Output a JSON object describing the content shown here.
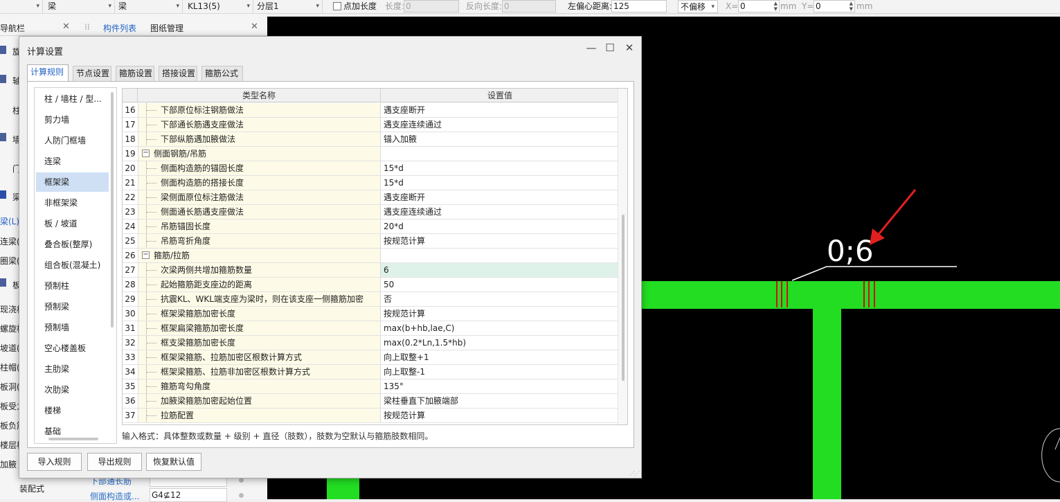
{
  "toolbar": {
    "type_value": "梁",
    "subtype_value": "梁",
    "component_value": "KL13(5)",
    "layer_value": "分层1",
    "point_length_label": "点加长度",
    "length_label": "长度:",
    "length_value": "0",
    "reverse_length_label": "反向长度:",
    "reverse_length_value": "0",
    "left_offset_label": "左偏心距离:",
    "left_offset_value": "125",
    "offset_mode": "不偏移",
    "x_label": "X=",
    "x_value": "0",
    "x_unit": "mm",
    "y_label": "Y=",
    "y_value": "0",
    "y_unit": "mm"
  },
  "left_panel": {
    "nav_tab": "导航栏",
    "component_list_tab": "构件列表",
    "drawing_tab": "图纸管理",
    "side_items": [
      "旋",
      "轴",
      "柱",
      "墙",
      "门",
      "梁",
      "梁(L)",
      "连梁(G",
      "圈梁(E",
      "板",
      "现浇板",
      "螺旋板",
      "坡道(P",
      "柱帽(V",
      "板洞(N",
      "板受力",
      "板负筋",
      "楼层板",
      "加腋",
      "装配式"
    ],
    "bottom_rows": [
      {
        "label": "下部通长筋",
        "value": ""
      },
      {
        "label": "侧面构造或...",
        "value": "G4⊈12"
      }
    ]
  },
  "canvas": {
    "annotation_text": "0;6"
  },
  "dialog": {
    "title": "计算设置",
    "tabs": [
      "计算规则",
      "节点设置",
      "箍筋设置",
      "搭接设置",
      "箍筋公式"
    ],
    "categories": [
      "柱 / 墙柱 / 型...",
      "剪力墙",
      "人防门框墙",
      "连梁",
      "框架梁",
      "非框架梁",
      "板 / 坡道",
      "叠合板(整厚)",
      "组合板(混凝土)",
      "预制柱",
      "预制梁",
      "预制墙",
      "空心楼盖板",
      "主肋梁",
      "次肋梁",
      "楼梯",
      "基础"
    ],
    "selected_category": "框架梁",
    "grid_headers": [
      "类型名称",
      "设置值"
    ],
    "rows": [
      {
        "num": "16",
        "name": "下部原位标注钢筋做法",
        "value": "遇支座断开"
      },
      {
        "num": "17",
        "name": "下部通长筋遇支座做法",
        "value": "遇支座连续通过"
      },
      {
        "num": "18",
        "name": "下部纵筋遇加腋做法",
        "value": "锚入加腋"
      },
      {
        "num": "19",
        "name": "侧面钢筋/吊筋",
        "value": "",
        "group": true
      },
      {
        "num": "20",
        "name": "侧面构造筋的锚固长度",
        "value": "15*d"
      },
      {
        "num": "21",
        "name": "侧面构造筋的搭接长度",
        "value": "15*d"
      },
      {
        "num": "22",
        "name": "梁侧面原位标注筋做法",
        "value": "遇支座断开"
      },
      {
        "num": "23",
        "name": "侧面通长筋遇支座做法",
        "value": "遇支座连续通过"
      },
      {
        "num": "24",
        "name": "吊筋锚固长度",
        "value": "20*d"
      },
      {
        "num": "25",
        "name": "吊筋弯折角度",
        "value": "按规范计算"
      },
      {
        "num": "26",
        "name": "箍筋/拉筋",
        "value": "",
        "group": true
      },
      {
        "num": "27",
        "name": "次梁两侧共增加箍筋数量",
        "value": "6",
        "highlight": true
      },
      {
        "num": "28",
        "name": "起始箍筋距支座边的距离",
        "value": "50"
      },
      {
        "num": "29",
        "name": "抗震KL、WKL端支座为梁时，则在该支座一侧箍筋加密",
        "value": "否"
      },
      {
        "num": "30",
        "name": "框架梁箍筋加密长度",
        "value": "按规范计算"
      },
      {
        "num": "31",
        "name": "框架扁梁箍筋加密长度",
        "value": "max(b+hb,lae,C)"
      },
      {
        "num": "32",
        "name": "框支梁箍筋加密长度",
        "value": "max(0.2*Ln,1.5*hb)"
      },
      {
        "num": "33",
        "name": "框架梁箍筋、拉筋加密区根数计算方式",
        "value": "向上取整+1"
      },
      {
        "num": "34",
        "name": "框架梁箍筋、拉筋非加密区根数计算方式",
        "value": "向上取整-1"
      },
      {
        "num": "35",
        "name": "箍筋弯勾角度",
        "value": "135°"
      },
      {
        "num": "36",
        "name": "加腋梁箍筋加密起始位置",
        "value": "梁柱垂直下加腋端部"
      },
      {
        "num": "37",
        "name": "拉筋配置",
        "value": "按规范计算"
      }
    ],
    "hint": "输入格式：具体整数或数量 + 级别 + 直径（肢数），肢数为空默认与箍筋肢数相同。",
    "buttons": {
      "import": "导入规则",
      "export": "导出规则",
      "restore": "恢复默认值"
    }
  },
  "colors": {
    "beam_green": "#22dd22",
    "annotation_arrow": "#e02020",
    "highlight_row": "#dff2ea",
    "name_column": "#fdfbe7",
    "selection_blue": "#cfe0f5",
    "active_tab_text": "#2161c6"
  }
}
